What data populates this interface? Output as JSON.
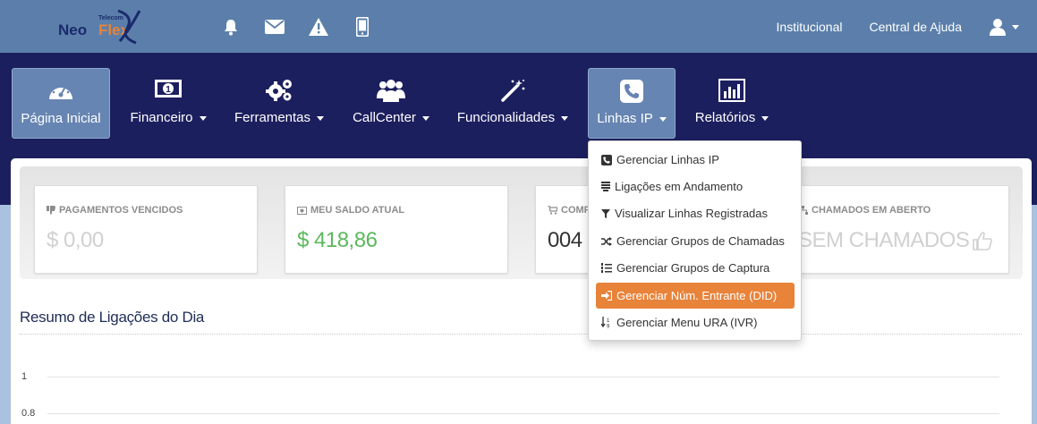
{
  "brand": {
    "logo_word1": "Neo",
    "logo_word2": "Flex",
    "logo_tag": "Telecom"
  },
  "top_icons": [
    "bell-icon",
    "envelope-icon",
    "warning-icon",
    "mobile-icon"
  ],
  "top_links": {
    "institucional": "Institucional",
    "ajuda": "Central de Ajuda"
  },
  "nav": {
    "items": [
      {
        "label": "Página Inicial",
        "icon": "dashboard-icon",
        "dropdown": false,
        "active": true
      },
      {
        "label": "Financeiro",
        "icon": "money-icon",
        "dropdown": true,
        "active": false
      },
      {
        "label": "Ferramentas",
        "icon": "gears-icon",
        "dropdown": true,
        "active": false
      },
      {
        "label": "CallCenter",
        "icon": "users-icon",
        "dropdown": true,
        "active": false
      },
      {
        "label": "Funcionalidades",
        "icon": "magic-wand-icon",
        "dropdown": true,
        "active": false
      },
      {
        "label": "Linhas IP",
        "icon": "phone-icon",
        "dropdown": true,
        "active": true
      },
      {
        "label": "Relatórios",
        "icon": "bar-chart-icon",
        "dropdown": true,
        "active": false
      }
    ]
  },
  "cards": [
    {
      "title": "PAGAMENTOS VENCIDOS",
      "value": "$ 0,00",
      "color": "#d0d0d0",
      "icon": "thumbs-down-icon"
    },
    {
      "title": "MEU SALDO ATUAL",
      "value": "$ 418,86",
      "color": "#5cb85c",
      "icon": "money-icon"
    },
    {
      "title": "COMP",
      "value": "004 (",
      "color": "#333333",
      "icon": "cart-icon"
    },
    {
      "title": "CHAMADOS EM ABERTO",
      "value": "SEM CHAMADOS",
      "color": "#d0d0d0",
      "icon": "sitemap-icon"
    }
  ],
  "section": {
    "title": "Resumo de Ligações do Dia"
  },
  "chart": {
    "y_ticks": [
      "1",
      "0.8"
    ]
  },
  "dropdown": {
    "items": [
      {
        "label": "Gerenciar Linhas IP",
        "icon": "phone-square-icon",
        "highlighted": false
      },
      {
        "label": "Ligações em Andamento",
        "icon": "list-icon",
        "highlighted": false
      },
      {
        "label": "Visualizar Linhas Registradas",
        "icon": "filter-icon",
        "highlighted": false
      },
      {
        "label": "Gerenciar Grupos de Chamadas",
        "icon": "shuffle-icon",
        "highlighted": false
      },
      {
        "label": "Gerenciar Grupos de Captura",
        "icon": "list-ol-icon",
        "highlighted": false
      },
      {
        "label": "Gerenciar Núm. Entrante (DID)",
        "icon": "sign-in-icon",
        "highlighted": true
      },
      {
        "label": "Gerenciar Menu URA (IVR)",
        "icon": "sort-numeric-icon",
        "highlighted": false
      }
    ]
  },
  "colors": {
    "topbar": "#5b7faa",
    "navbar": "#1c1f5e",
    "accent": "#e8833a",
    "active_nav": "#6685b2"
  }
}
